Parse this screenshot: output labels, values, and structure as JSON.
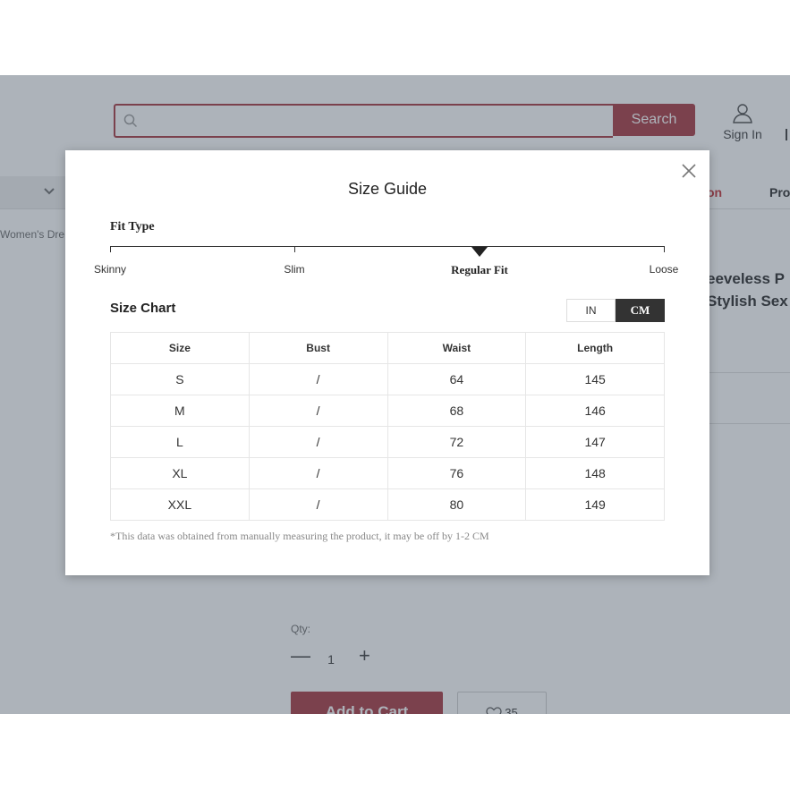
{
  "header": {
    "search_placeholder": "",
    "search_button": "Search",
    "sign_in": "Sign In"
  },
  "nav": {
    "promo_label": "on",
    "products_label": "Pro"
  },
  "breadcrumb": "Women's Dre",
  "product": {
    "title_line1": "eeveless P",
    "title_line2": "Stylish Sex",
    "qty_label": "Qty:",
    "qty_value": "1",
    "add_to_cart": "Add to Cart",
    "wishlist_count": "35"
  },
  "modal": {
    "title": "Size Guide",
    "fit_type": {
      "heading": "Fit Type",
      "options": [
        "Skinny",
        "Slim",
        "Regular Fit",
        "Loose"
      ],
      "selected": "Regular Fit"
    },
    "size_chart": {
      "heading": "Size Chart",
      "units": [
        "IN",
        "CM"
      ],
      "selected_unit": "CM",
      "columns": [
        "Size",
        "Bust",
        "Waist",
        "Length"
      ],
      "rows": [
        [
          "S",
          "/",
          "64",
          "145"
        ],
        [
          "M",
          "/",
          "68",
          "146"
        ],
        [
          "L",
          "/",
          "72",
          "147"
        ],
        [
          "XL",
          "/",
          "76",
          "148"
        ],
        [
          "XXL",
          "/",
          "80",
          "149"
        ]
      ]
    },
    "footnote": "*This data was obtained from manually measuring the product, it may be off by 1-2 CM"
  },
  "colors": {
    "brand": "#a5313a",
    "promo": "#c0272d",
    "active_unit": "#333333",
    "overlay": "#4a5765"
  },
  "icons": [
    "search-icon",
    "user-icon",
    "chevron-down-icon",
    "close-icon",
    "minus-icon",
    "plus-icon",
    "heart-icon",
    "pointer-triangle-icon"
  ]
}
